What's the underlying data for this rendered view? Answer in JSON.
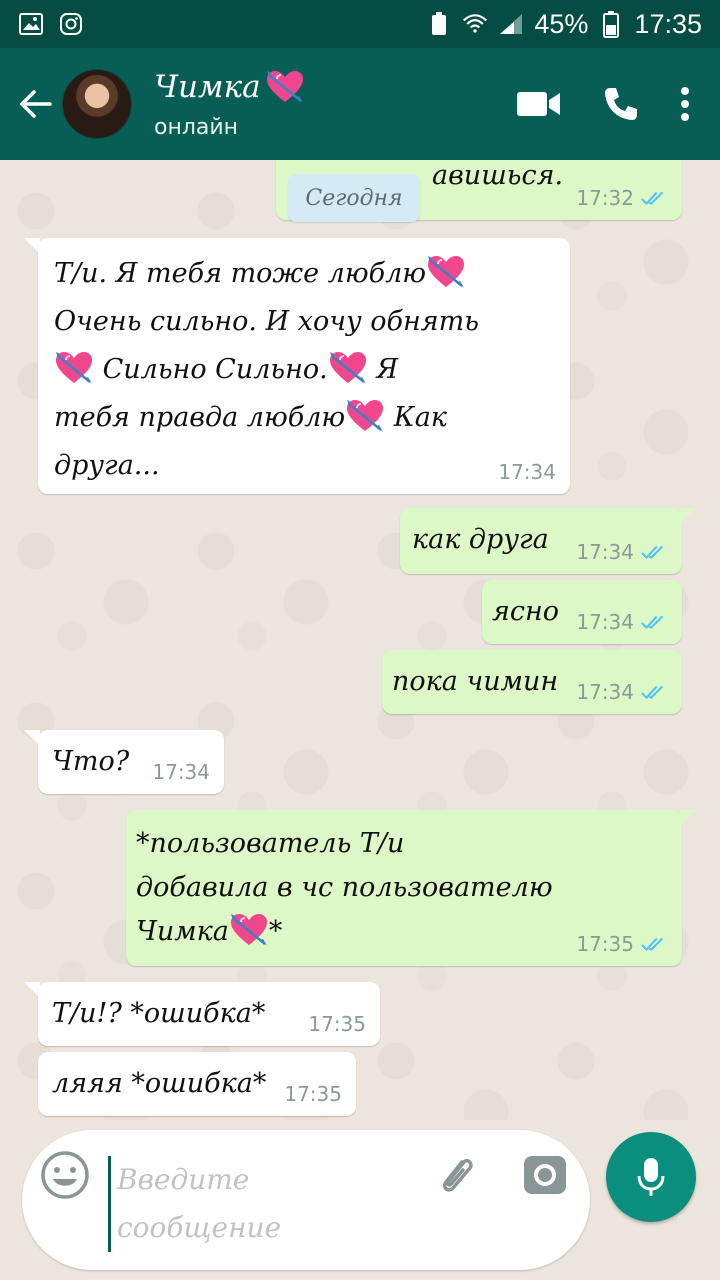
{
  "status_bar": {
    "battery": "45%",
    "time": "17:35"
  },
  "header": {
    "contact_name": "Чимка",
    "contact_status": "онлайн"
  },
  "chat": {
    "date_label": "Сегодня",
    "partial_message": {
      "text": "авишься.",
      "time": "17:32"
    },
    "messages": [
      {
        "dir": "in",
        "lines": [
          "Т/и. Я тебя тоже люблю",
          "Очень сильно. И хочу обнять",
          "Сильно Сильно.",
          "Я",
          "тебя правда люблю",
          "Как",
          "друга..."
        ],
        "time": "17:34"
      },
      {
        "dir": "out",
        "text": "как друга",
        "time": "17:34"
      },
      {
        "dir": "out",
        "text": "ясно",
        "time": "17:34"
      },
      {
        "dir": "out",
        "text": "пока чимин",
        "time": "17:34"
      },
      {
        "dir": "in",
        "text": "Что?",
        "time": "17:34"
      },
      {
        "dir": "out",
        "lines": [
          "*пользователь Т/и",
          "добавила в чс пользователю",
          "Чимка",
          "*"
        ],
        "time": "17:35"
      },
      {
        "dir": "in",
        "text": "Т/и!? *ошибка*",
        "time": "17:35"
      },
      {
        "dir": "in",
        "text": "ляяя *ошибка*",
        "time": "17:35"
      }
    ]
  },
  "composer": {
    "placeholder_line1": "Введите",
    "placeholder_line2": "сообщение"
  },
  "colors": {
    "header_bg": "#075e54",
    "status_bg": "#054d44",
    "outgoing_bubble": "#dcf8c6",
    "incoming_bubble": "#ffffff",
    "tick_blue": "#4fc3f7",
    "mic_button": "#0a8f7e"
  },
  "icons": [
    "back-arrow-icon",
    "video-call-icon",
    "phone-icon",
    "more-vert-icon",
    "emoji-icon",
    "attach-icon",
    "camera-icon",
    "mic-icon",
    "double-check-icon",
    "heart-arrow-emoji"
  ]
}
